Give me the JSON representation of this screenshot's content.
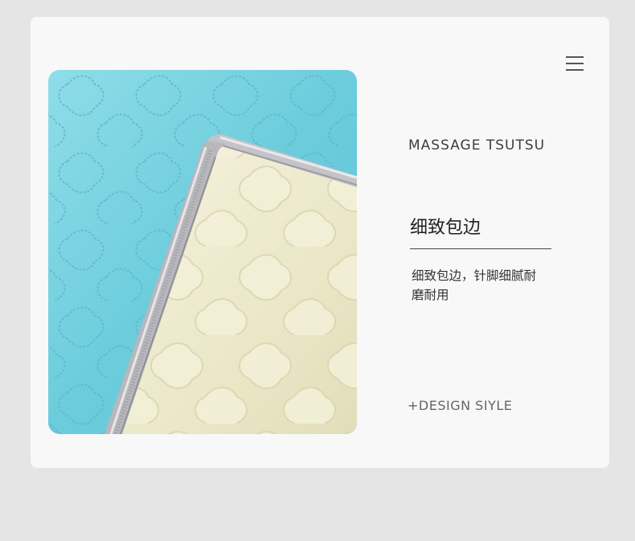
{
  "menu": {
    "icon": "hamburger-menu-icon"
  },
  "product": {
    "brand": "MASSAGE TSUTSU",
    "image": "quilted-mat-edge-photo",
    "colors": {
      "top_fabric": "#6fd0df",
      "bottom_fabric": "#efeccf",
      "binding": "#b8b8bc"
    }
  },
  "feature": {
    "title": "细致包边",
    "description": "细致包边，针脚细腻耐磨耐用"
  },
  "footer": {
    "tag": "+DESIGN SIYLE"
  }
}
